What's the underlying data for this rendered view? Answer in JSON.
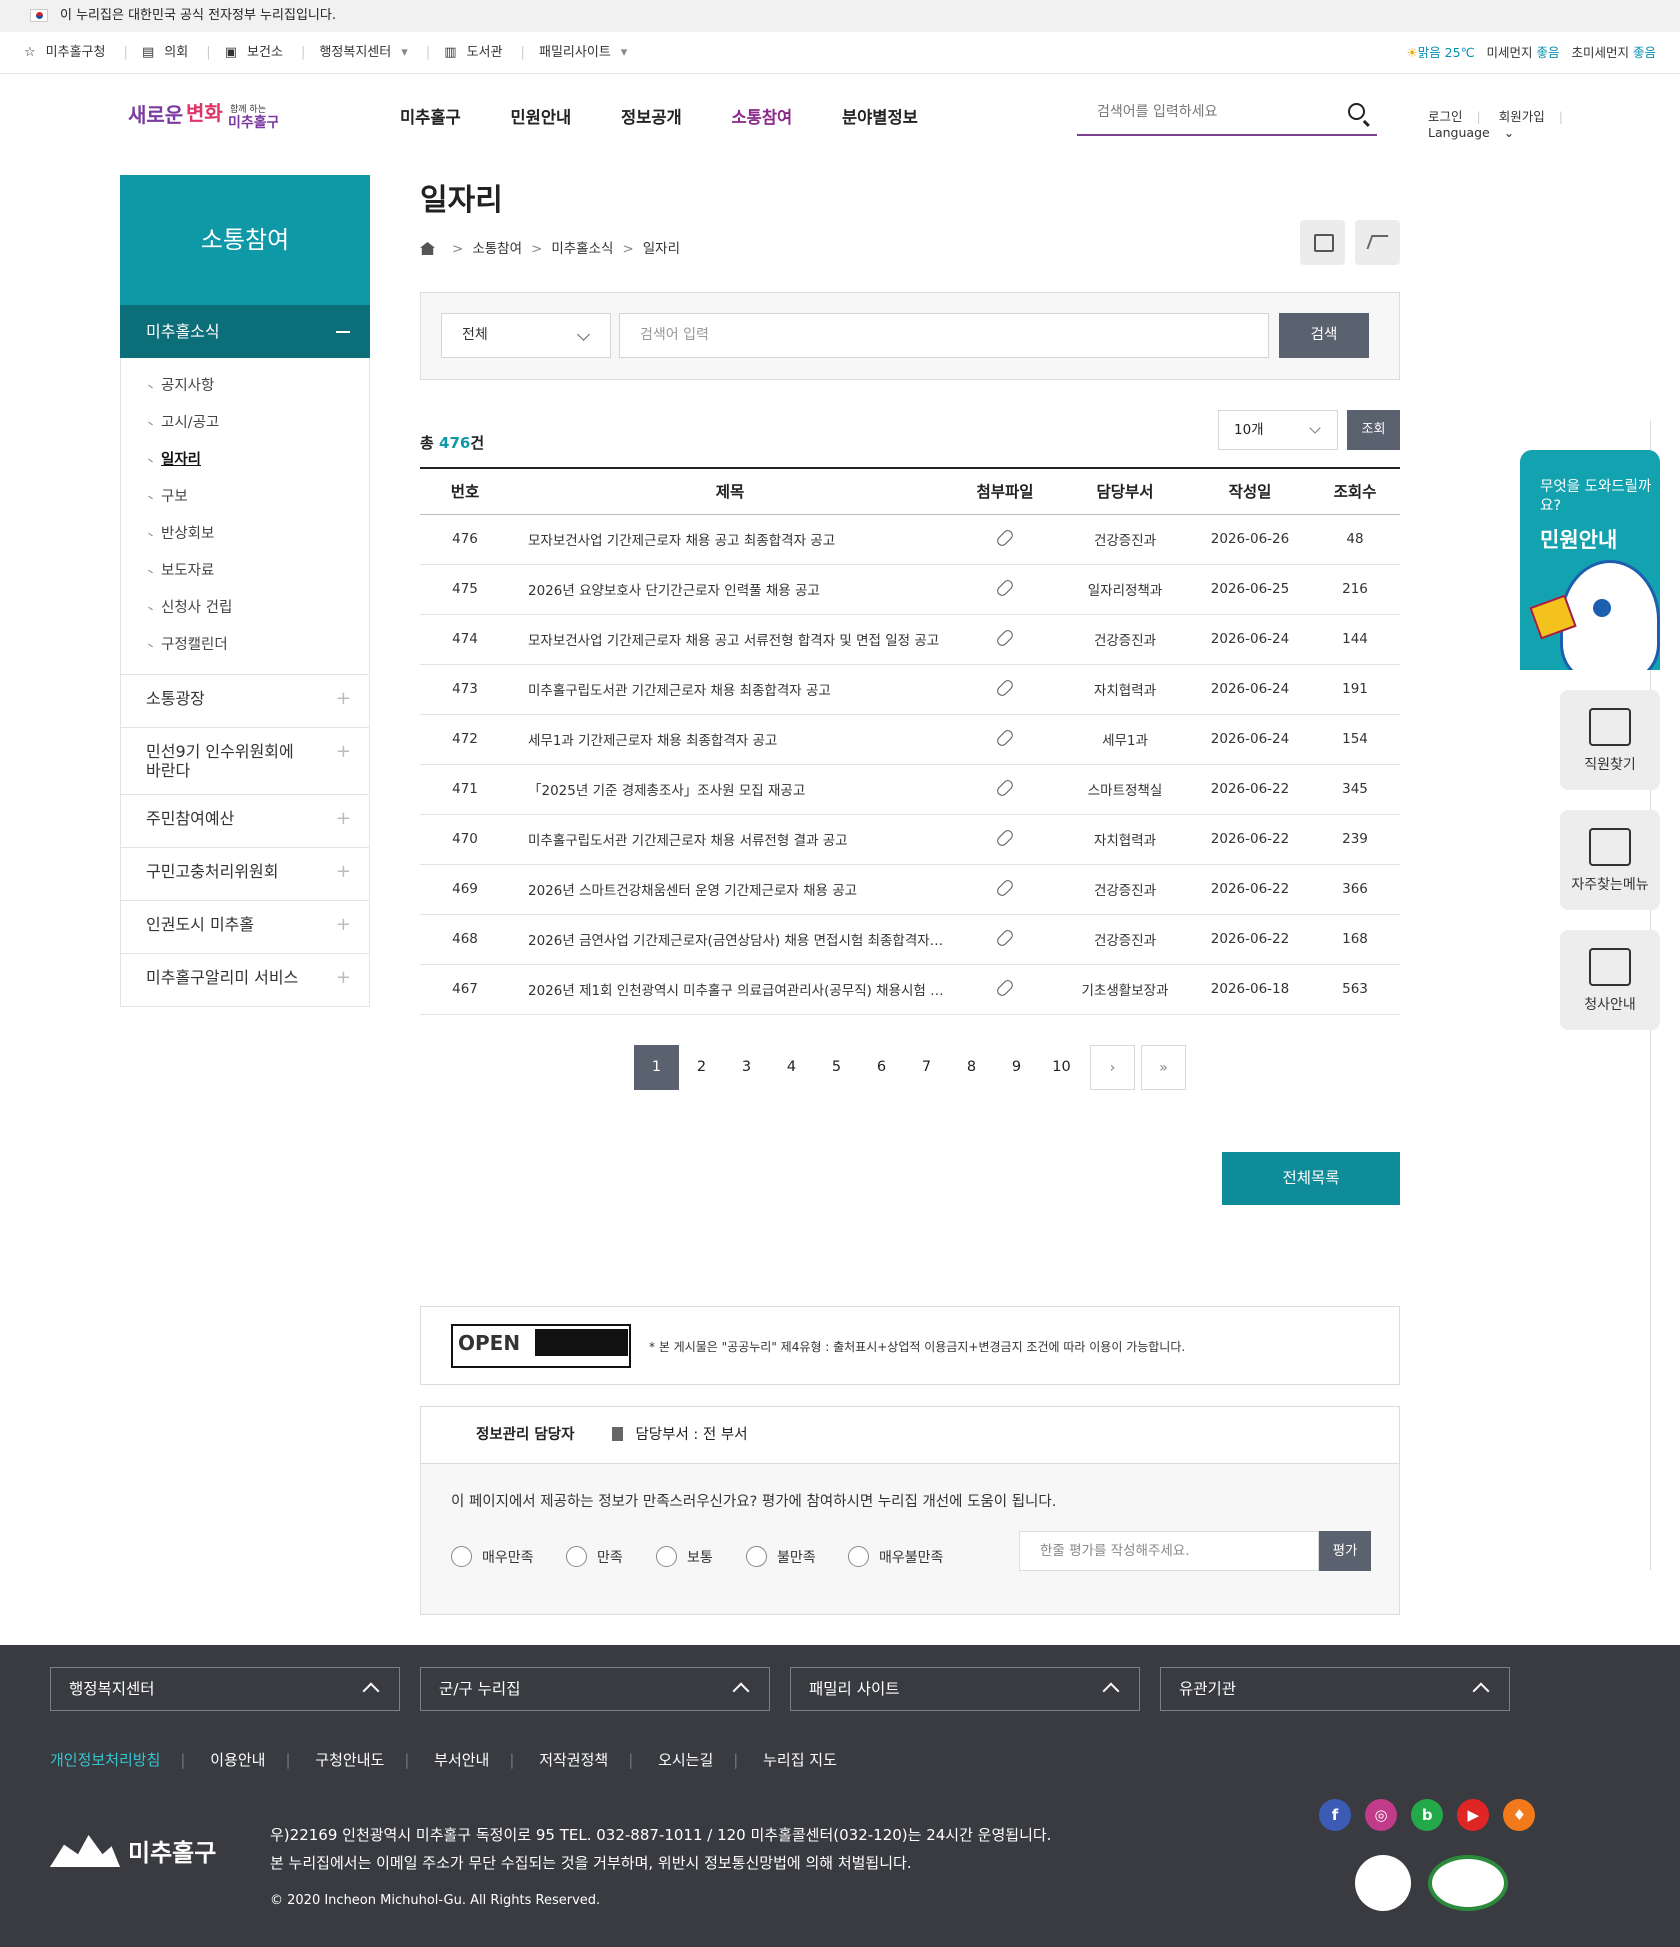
{
  "gov_banner": "이 누리집은 대한민국 공식 전자정부 누리집입니다.",
  "topbar": {
    "links": [
      "미추홀구청",
      "의회",
      "보건소",
      "행정복지센터",
      "도서관",
      "패밀리사이트"
    ],
    "weather": {
      "sky": "맑음 25℃",
      "dust_label": "미세먼지",
      "dust": "좋음",
      "fine_dust_label": "초미세먼지",
      "fine_dust": "좋음"
    }
  },
  "header": {
    "logo_text": "새로운변화 함께 하는 미추홀구",
    "gnb": [
      "미추홀구",
      "민원안내",
      "정보공개",
      "소통참여",
      "분야별정보"
    ],
    "gnb_active": "소통참여",
    "search_placeholder": "검색어를 입력하세요",
    "util": [
      "로그인",
      "회원가입",
      "Language"
    ]
  },
  "sidebar": {
    "title": "소통참여",
    "current": "미추홀소식",
    "sub_items": [
      "공지사항",
      "고시/공고",
      "일자리",
      "구보",
      "반상회보",
      "보도자료",
      "신청사 건립",
      "구정캘린더"
    ],
    "active_sub": "일자리",
    "items": [
      "소통광장",
      "민선9기 인수위원회에 바란다",
      "주민참여예산",
      "구민고충처리위원회",
      "인권도시 미추홀",
      "미추홀구알리미 서비스"
    ]
  },
  "page": {
    "title": "일자리",
    "breadcrumb": [
      "소통참여",
      "미추홀소식",
      "일자리"
    ]
  },
  "search": {
    "select": "전체",
    "placeholder": "검색어 입력",
    "button": "검색"
  },
  "list": {
    "total_prefix": "총",
    "total": "476",
    "total_suffix": "건",
    "per_page": "10개",
    "view_button": "조회",
    "columns": [
      "번호",
      "제목",
      "첨부파일",
      "담당부서",
      "작성일",
      "조회수"
    ],
    "rows": [
      {
        "no": "476",
        "title": "모자보건사업 기간제근로자 채용 공고 최종합격자 공고",
        "dept": "건강증진과",
        "date": "2026-06-26",
        "views": "48"
      },
      {
        "no": "475",
        "title": "2026년 요양보호사 단기간근로자 인력풀 채용 공고",
        "dept": "일자리정책과",
        "date": "2026-06-25",
        "views": "216"
      },
      {
        "no": "474",
        "title": "모자보건사업 기간제근로자 채용 공고 서류전형 합격자 및 면접 일정 공고",
        "dept": "건강증진과",
        "date": "2026-06-24",
        "views": "144"
      },
      {
        "no": "473",
        "title": "미추홀구립도서관 기간제근로자 채용 최종합격자 공고",
        "dept": "자치협력과",
        "date": "2026-06-24",
        "views": "191"
      },
      {
        "no": "472",
        "title": "세무1과 기간제근로자 채용 최종합격자 공고",
        "dept": "세무1과",
        "date": "2026-06-24",
        "views": "154"
      },
      {
        "no": "471",
        "title": "「2025년 기준 경제총조사」조사원 모집 재공고",
        "dept": "스마트정책실",
        "date": "2026-06-22",
        "views": "345"
      },
      {
        "no": "470",
        "title": "미추홀구립도서관 기간제근로자 채용 서류전형 결과 공고",
        "dept": "자치협력과",
        "date": "2026-06-22",
        "views": "239"
      },
      {
        "no": "469",
        "title": "2026년 스마트건강채움센터 운영 기간제근로자 채용 공고",
        "dept": "건강증진과",
        "date": "2026-06-22",
        "views": "366"
      },
      {
        "no": "468",
        "title": "2026년 금연사업 기간제근로자(금연상담사) 채용 면접시험 최종합격자…",
        "dept": "건강증진과",
        "date": "2026-06-22",
        "views": "168"
      },
      {
        "no": "467",
        "title": "2026년 제1회 인천광역시 미추홀구 의료급여관리사(공무직) 채용시험 …",
        "dept": "기초생활보장과",
        "date": "2026-06-18",
        "views": "563"
      }
    ]
  },
  "pager": {
    "pages": [
      "1",
      "2",
      "3",
      "4",
      "5",
      "6",
      "7",
      "8",
      "9",
      "10"
    ],
    "current": "1",
    "next": "›",
    "last": "»"
  },
  "list_button": "전체목록",
  "kogl": {
    "mark": "OPEN",
    "text": "* 본 게시물은 \"공공누리\" 제4유형 : 출처표시+상업적 이용금지+변경금지 조건에 따라 이용이 가능합니다."
  },
  "info": {
    "manager_label": "정보관리 담당자",
    "dept": "담당부서 : 전 부서",
    "question": "이 페이지에서 제공하는 정보가 만족스러우신가요? 평가에 참여하시면 누리집 개선에 도움이 됩니다.",
    "options": [
      "매우만족",
      "만족",
      "보통",
      "불만족",
      "매우불만족"
    ],
    "comment_placeholder": "한줄 평가를 작성해주세요.",
    "submit": "평가"
  },
  "quick": {
    "big_small": "무엇을 도와드릴까요?",
    "big_title": "민원안내",
    "buttons": [
      "직원찾기",
      "자주찾는메뉴",
      "청사안내"
    ]
  },
  "footer": {
    "selects": [
      "행정복지센터",
      "군/구 누리집",
      "패밀리 사이트",
      "유관기관"
    ],
    "links": [
      "개인정보처리방침",
      "이용안내",
      "구청안내도",
      "부서안내",
      "저작권정책",
      "오시는길",
      "누리집 지도"
    ],
    "logo": "미추홀구",
    "address": "우)22169 인천광역시 미추홀구 독정이로 95   TEL. 032-887-1011 / 120 미추홀콜센터(032-120)는 24시간 운영됩니다.",
    "notice": "본 누리집에서는 이메일 주소가 무단 수집되는 것을 거부하며, 위반시 정보통신망법에 의해 처벌됩니다.",
    "copyright": "© 2020 Incheon Michuhol-Gu. All Rights Reserved.",
    "sns": [
      "f",
      "◎",
      "b",
      "▶",
      "♦"
    ]
  }
}
